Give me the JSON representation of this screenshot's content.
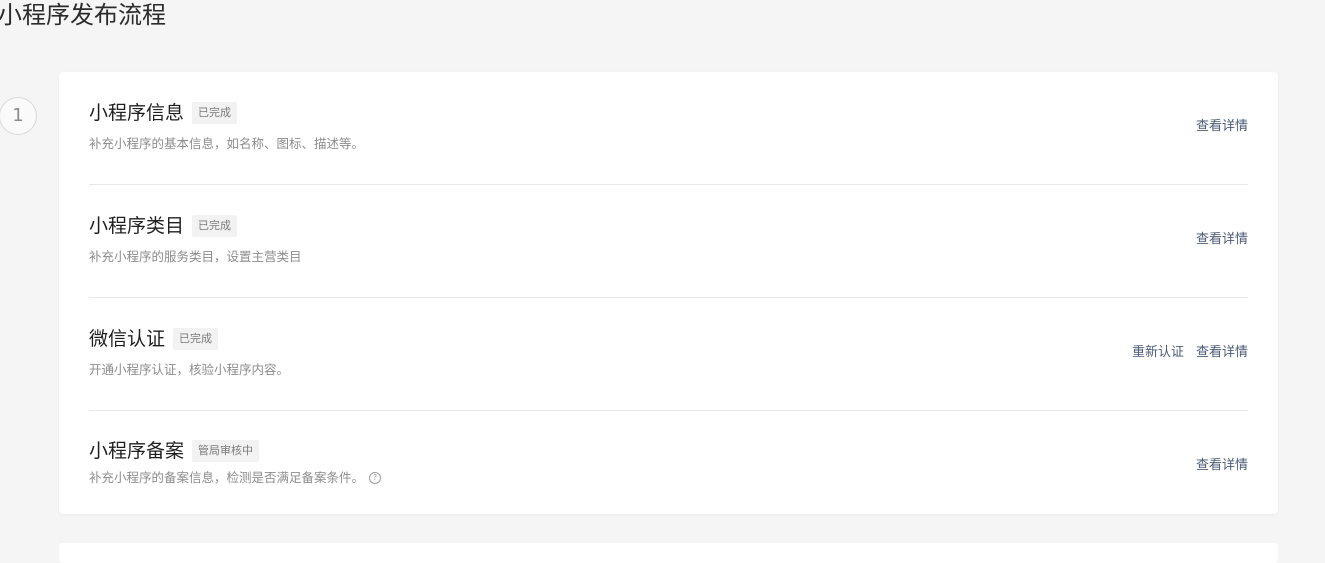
{
  "page": {
    "title": "小程序发布流程"
  },
  "step": {
    "number": "1"
  },
  "items": [
    {
      "title": "小程序信息",
      "status": "已完成",
      "desc": "补充小程序的基本信息，如名称、图标、描述等。",
      "actions": [
        "查看详情"
      ]
    },
    {
      "title": "小程序类目",
      "status": "已完成",
      "desc": "补充小程序的服务类目，设置主营类目",
      "actions": [
        "查看详情"
      ]
    },
    {
      "title": "微信认证",
      "status": "已完成",
      "desc": "开通小程序认证，核验小程序内容。",
      "actions": [
        "重新认证",
        "查看详情"
      ]
    },
    {
      "title": "小程序备案",
      "status": "管局审核中",
      "desc": "补充小程序的备案信息，检测是否满足备案条件。",
      "help_icon": "?",
      "actions": [
        "查看详情"
      ]
    }
  ],
  "colors": {
    "background": "#f5f5f5",
    "card": "#ffffff",
    "link": "#4a5a75",
    "badge_bg": "#f2f2f2"
  }
}
